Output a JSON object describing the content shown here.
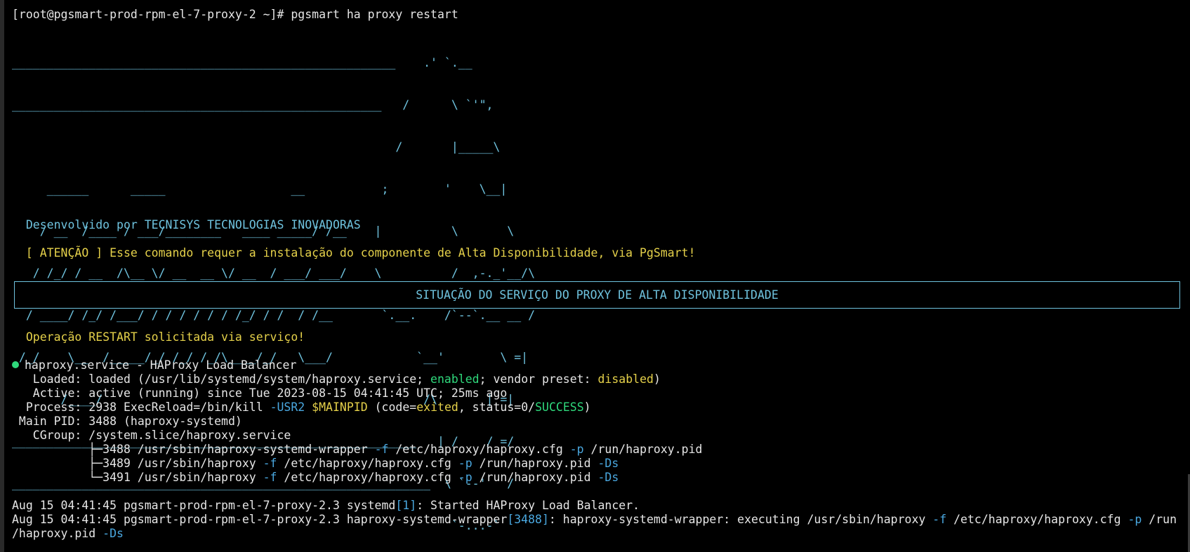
{
  "terminal": {
    "prompt": "[root@pgsmart-prod-rpm-el-7-proxy-2 ~]# ",
    "command": "pgsmart ha proxy restart"
  },
  "banner": {
    "logo_lines": [
      "_______________________________________________________    .' `.__",
      "_____________________________________________________   /      \\ `'\",",
      "                                                       /       |_____\\",
      "     ______      _____                  __           ;        '    \\__|",
      "    / __  /____ / ___/________   ____ _____/ /__    |          \\       \\",
      "   / /_/ / __  /\\__ \\/ __  __ \\/ __  / ___/ ___/    \\          /  ,-._'__/\\",
      "  / ____/ /_/ /___/ / / / / / / /_/ / /  / /__       `.__.    /`--`.__ __ /",
      " /_/    \\__  /_____/_/ /_/ /_/\\____/_/   \\___/            `__'        \\ =|",
      "       /____/                                              /\\       | =|",
      "__________________________________________________________   | /    / =/",
      "____________________________________________________________  \\ `--'   /",
      "                                                               `-...-`"
    ]
  },
  "info": {
    "developer": "Desenvolvido por TECNISYS TECNOLOGIAS INOVADORAS",
    "attention": "[ ATENÇÃO ] Esse comando requer a instalação do componente de Alta Disponibilidade, via PgSmart!",
    "status_title": "SITUAÇÃO DO SERVIÇO DO PROXY DE ALTA DISPONIBILIDADE",
    "operation": "Operação RESTART solicitada via serviço!"
  },
  "service": {
    "header": "haproxy.service - HAProxy Load Balancer",
    "loaded_label": "   Loaded: ",
    "loaded_pre": "loaded (/usr/lib/systemd/system/haproxy.service; ",
    "loaded_enabled": "enabled",
    "loaded_mid": "; vendor preset: ",
    "loaded_disabled": "disabled",
    "loaded_post": ")",
    "active_label": "   Active: ",
    "active_value": "active (running) since Tue 2023-08-15 04:41:45 UTC; 25ms ago",
    "process_label": "  Process: ",
    "process_pre": "2938 ExecReload=/bin/kill ",
    "process_usr2": "-USR2",
    "process_mainpid": "$MAINPID",
    "process_code": " (code=",
    "process_exited": "exited",
    "process_status": ", status=0/",
    "process_success": "SUCCESS",
    "process_post": ")",
    "mainpid_label": " Main PID: ",
    "mainpid_value": "3488 (haproxy-systemd)",
    "cgroup_label": "   CGroup: ",
    "cgroup_value": "/system.slice/haproxy.service",
    "tree": [
      {
        "prefix": "           ├─3488 /usr/sbin/haproxy-systemd-wrapper ",
        "f": "-f",
        "cfg": " /etc/haproxy/haproxy.cfg ",
        "p": "-p",
        "pid": " /run/haproxy.pid",
        "ds": ""
      },
      {
        "prefix": "           ├─3489 /usr/sbin/haproxy ",
        "f": "-f",
        "cfg": " /etc/haproxy/haproxy.cfg ",
        "p": "-p",
        "pid": " /run/haproxy.pid ",
        "ds": "-Ds"
      },
      {
        "prefix": "           └─3491 /usr/sbin/haproxy ",
        "f": "-f",
        "cfg": " /etc/haproxy/haproxy.cfg ",
        "p": "-p",
        "pid": " /run/haproxy.pid ",
        "ds": "-Ds"
      }
    ]
  },
  "logs": {
    "line1_pre": "Aug 15 04:41:45 pgsmart-prod-rpm-el-7-proxy-2.3 systemd",
    "line1_pid": "[1]",
    "line1_post": ": Started HAProxy Load Balancer.",
    "line2_pre": "Aug 15 04:41:45 pgsmart-prod-rpm-el-7-proxy-2.3 haproxy-systemd-wrapper",
    "line2_pid": "[3488]",
    "line2_mid": ": haproxy-systemd-wrapper: executing /usr/sbin/haproxy ",
    "line2_f": "-f",
    "line2_cfg": " /etc/haproxy/haproxy.cfg ",
    "line2_p": "-p",
    "line2_end": " /run",
    "line3_pre": "/haproxy.pid ",
    "line3_ds": "-Ds"
  },
  "colors": {
    "background": "#000000",
    "cyan": "#6fc3df",
    "yellow": "#e5d14a",
    "green": "#2fd97c",
    "blue": "#4aa8e0"
  }
}
